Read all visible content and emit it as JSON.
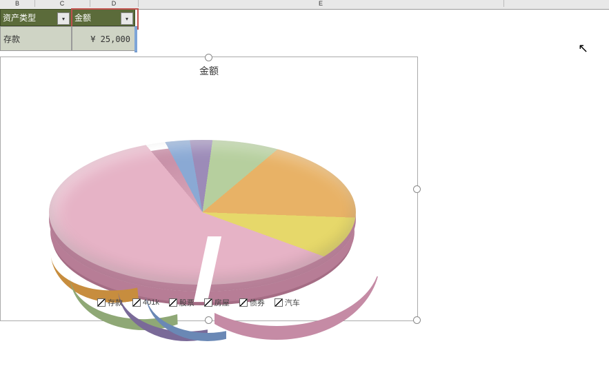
{
  "columns": {
    "b": "B",
    "c": "C",
    "d": "D",
    "e": "E"
  },
  "headers": {
    "asset_type": "资产类型",
    "amount": "金额"
  },
  "row": {
    "label": "存款",
    "value": "¥  25,000"
  },
  "chart": {
    "title": "金额"
  },
  "legend": [
    {
      "label": "存款"
    },
    {
      "label": "401k"
    },
    {
      "label": "股票"
    },
    {
      "label": "房屋"
    },
    {
      "label": "债券"
    },
    {
      "label": "汽车"
    }
  ],
  "chart_data": {
    "type": "pie",
    "title": "金额",
    "series": [
      {
        "name": "存款",
        "value": 25000,
        "pct_est": 58,
        "color": "#e6b3c6",
        "exploded": true
      },
      {
        "name": "401k",
        "value_est": null,
        "pct_est": 3,
        "color": "#e6d86a"
      },
      {
        "name": "股票",
        "value_est": null,
        "pct_est": 12,
        "color": "#e8b266"
      },
      {
        "name": "房屋",
        "value_est": null,
        "pct_est": 12,
        "color": "#b6cf9e"
      },
      {
        "name": "债券",
        "value_est": null,
        "pct_est": 5,
        "color": "#9c8bb8"
      },
      {
        "name": "汽车",
        "value_est": null,
        "pct_est": 5,
        "color": "#8aa9d4"
      }
    ],
    "note": "Only 存款 has a visible numeric value (¥25,000). Other slice values are estimated from angular share; a ~5% gap (white wedge) is the exploded offset, not data."
  }
}
